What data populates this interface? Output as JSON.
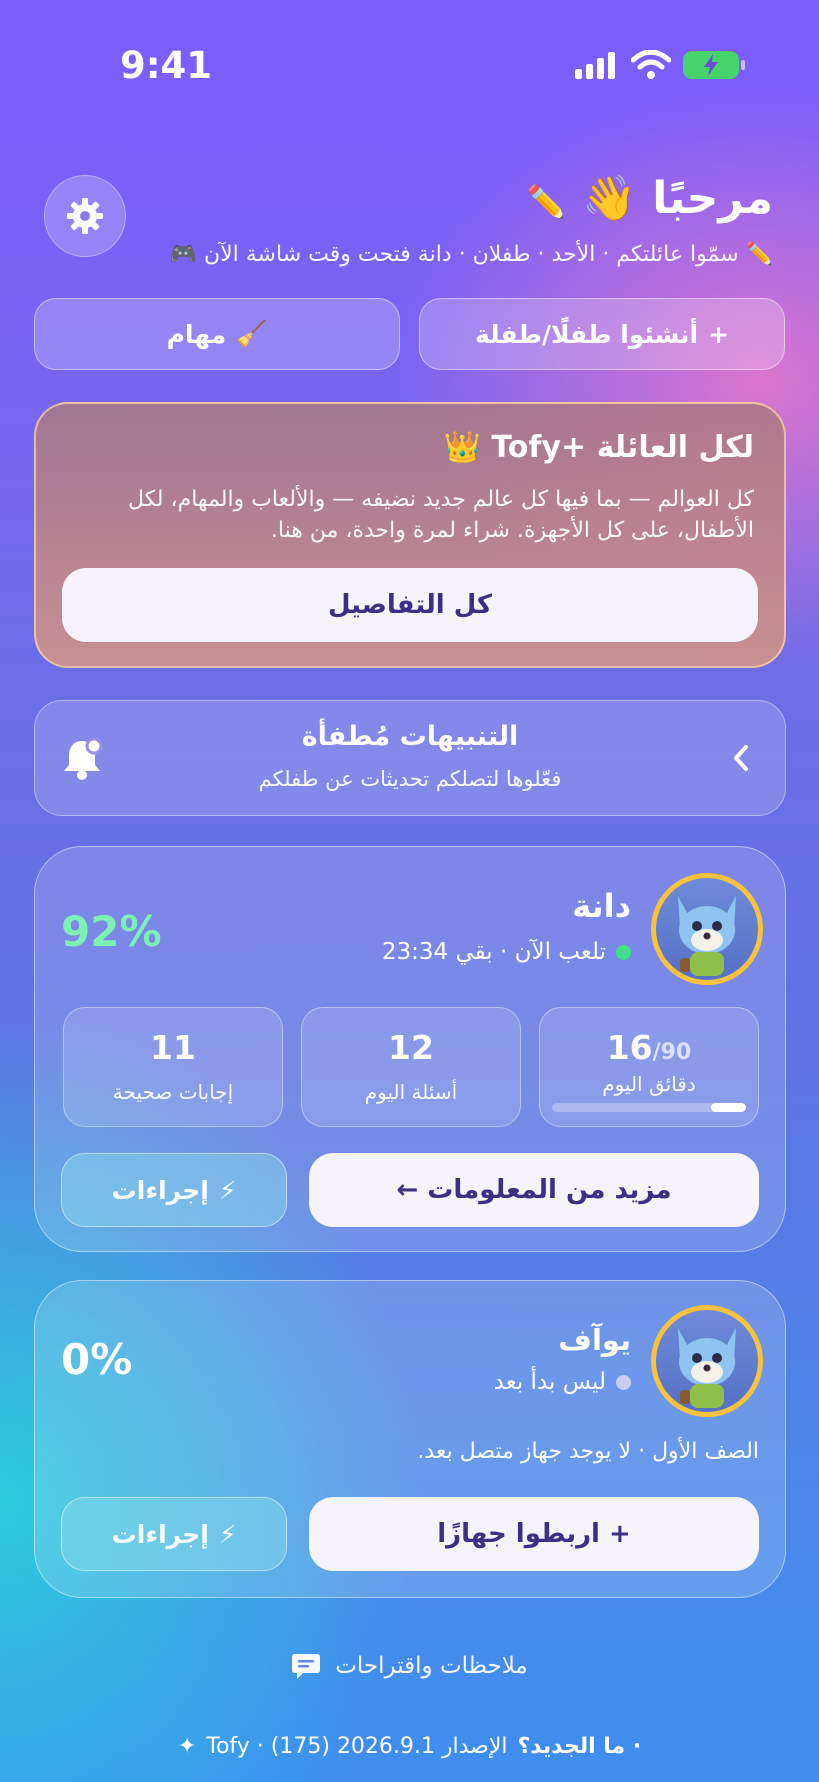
{
  "status_bar": {
    "time": "9:41"
  },
  "header": {
    "greeting": "مرحبًا",
    "subline": "سمّوا عائلتكم · الأحد · طفلان · دانة فتحت وقت شاشة الآن"
  },
  "quick_actions": {
    "create_child": "أنشئوا طفلًا/طفلة",
    "tasks": "مهام"
  },
  "promo": {
    "title": "لكل العائلة +Tofy",
    "description": "كل العوالم — بما فيها كل عالم جديد نضيفه — والألعاب والمهام، لكل الأطفال، على كل الأجهزة. شراء لمرة واحدة، من هنا.",
    "button": "كل التفاصيل"
  },
  "alerts": {
    "title": "التنبيهات مُطفأة",
    "subtitle": "فعّلوها لتصلكم تحديثات عن طفلكم"
  },
  "children": [
    {
      "name": "دانة",
      "status": "تلعب الآن · بقي 23:34",
      "status_color": "#3ee08a",
      "percent": "92%",
      "percent_color": "#7df0b4",
      "stats": [
        {
          "value": "16",
          "suffix": "/90",
          "label": "دقائق اليوم",
          "progress": 0.18
        },
        {
          "value": "12",
          "label": "أسئلة اليوم"
        },
        {
          "value": "11",
          "label": "إجابات صحيحة"
        }
      ],
      "primary_button": "مزيد من المعلومات ←",
      "actions_button": "إجراءات"
    },
    {
      "name": "يوآف",
      "status": "ليس بدأ بعد",
      "status_color": "#c9cdf2",
      "percent": "0%",
      "percent_color": "#ffffff",
      "note": "الصف الأول · لا يوجد جهاز متصل بعد.",
      "primary_button": "+ اربطوا جهازًا",
      "actions_button": "إجراءات"
    }
  ],
  "footer": {
    "feedback": "ملاحظات واقتراحات",
    "whats_new": "· ما الجديد؟",
    "version": "الإصدار 2026.9.1 (175) · Tofy"
  },
  "icons": {
    "settings": "gear-icon",
    "wave": "waving-hand-icon",
    "pencil": "pencil-icon",
    "broom": "broom-icon",
    "crown": "crown-icon",
    "bell": "bell-icon",
    "chevron": "chevron-left-icon",
    "lightning": "lightning-icon",
    "chat": "chat-bubble-icon",
    "sparkle": "sparkle-icon",
    "gamepad": "gamepad-icon"
  }
}
